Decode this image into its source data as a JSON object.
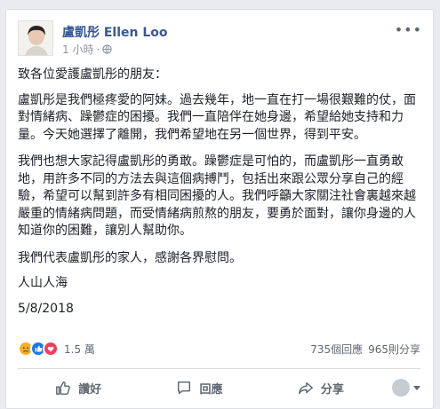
{
  "post": {
    "author": "盧凱彤 Ellen Loo",
    "time": "1 小時",
    "separator": "·",
    "more_icon": "more-options-icon",
    "paragraphs": [
      "致各位愛護盧凱彤的朋友：",
      "盧凱彤是我們極疼愛的阿妹。過去幾年，地一直在打一場很艱難的仗，面對情緒病、躁鬱症的困擾。我們一直陪伴在她身邊，希望給她支持和力量。今天她選擇了離開，我們希望地在另一個世界，得到平安。",
      "我們也想大家記得盧凱彤的勇敢。躁鬱症是可怕的，而盧凱彤一直勇敢地，用許多不同的方法去與這個病搏鬥，包括出來跟公眾分享自己的經驗，希望可以幫到許多有相同困擾的人。我們呼籲大家關注社會裏越來越嚴重的情緒病問題，而受情緒病煎熬的朋友，要勇於面對，讓你身邊的人知道你的困難，讓別人幫助你。",
      "我們代表盧凱彤的家人，感謝各界慰問。",
      "人山人海",
      "5/8/2018"
    ]
  },
  "reactions": {
    "icons": [
      "sad-reaction-icon",
      "like-reaction-icon",
      "love-reaction-icon"
    ],
    "count": "1.5 萬",
    "comments": "735個回應",
    "shares": "965則分享"
  },
  "actions": {
    "like": "讚好",
    "comment": "回應",
    "share": "分享"
  },
  "colors": {
    "link": "#365899",
    "muted": "#90949c",
    "action": "#606770",
    "like_blue": "#1877f2",
    "love_red": "#f33e58",
    "sad_yellow": "#f7b125"
  }
}
